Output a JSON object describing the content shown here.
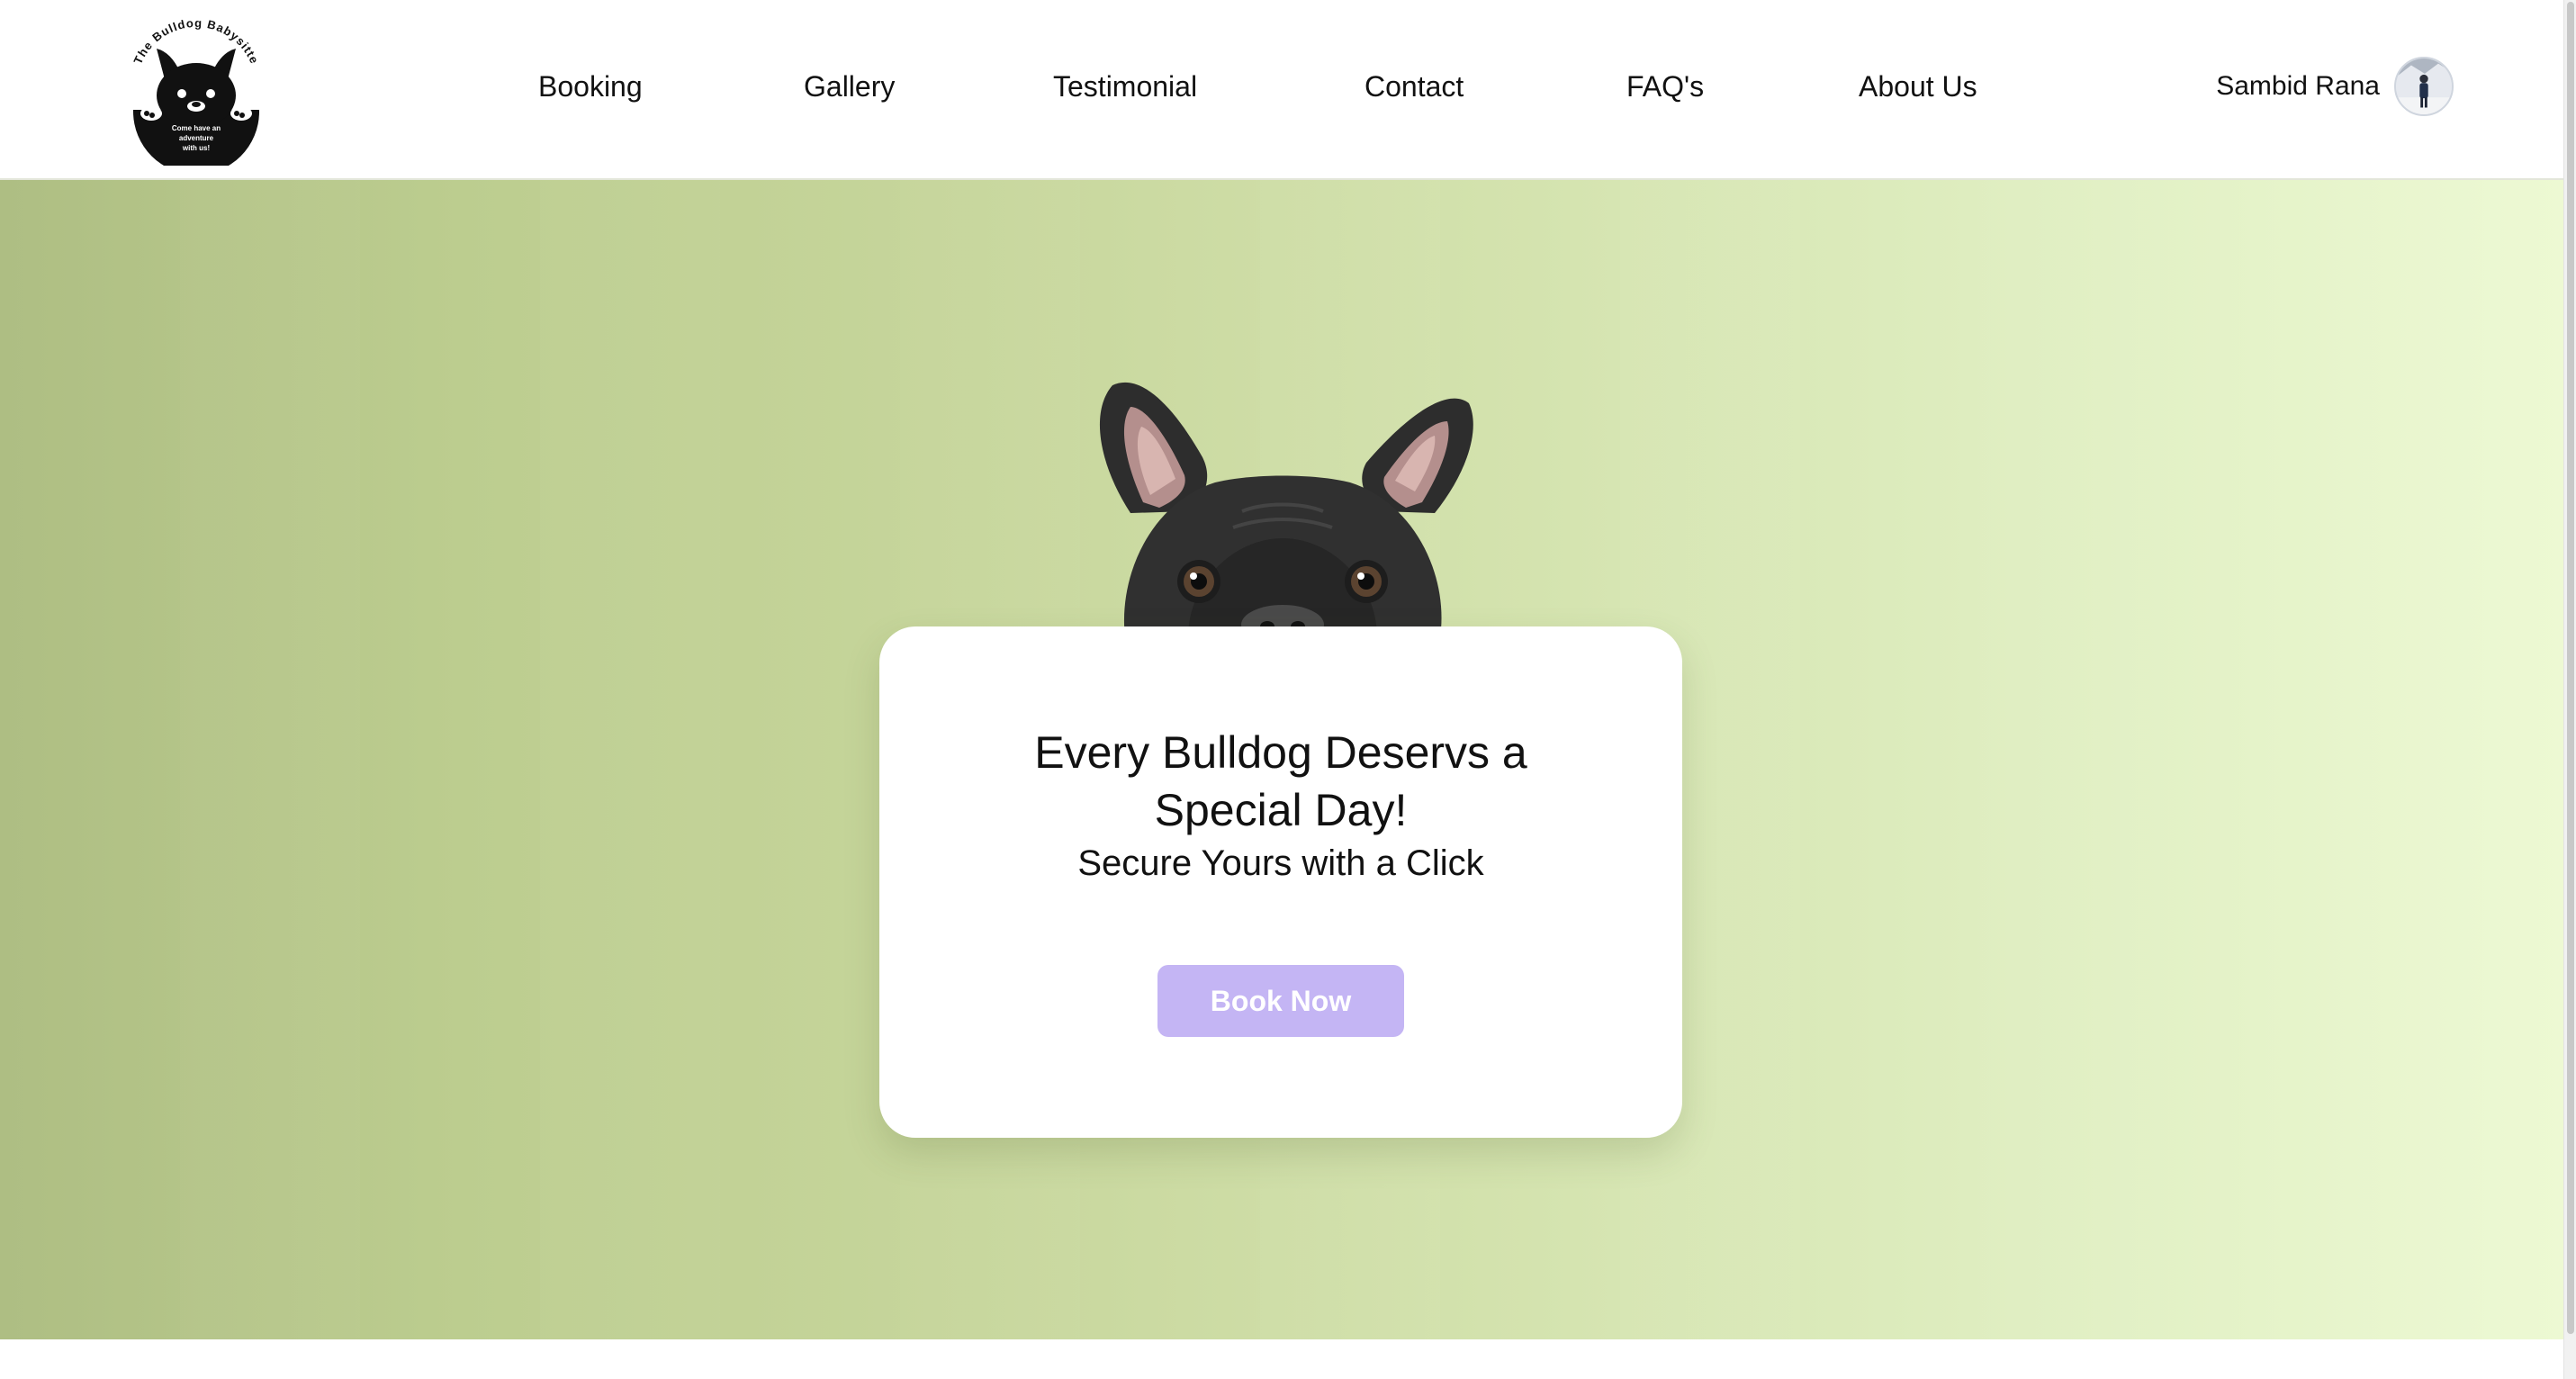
{
  "header": {
    "logo": {
      "arc_text": "The Bulldog Babysitte",
      "tagline_lines": [
        "Come have an",
        "adventure",
        "with us!"
      ]
    },
    "nav": [
      {
        "label": "Booking"
      },
      {
        "label": "Gallery"
      },
      {
        "label": "Testimonial"
      },
      {
        "label": "Contact"
      },
      {
        "label": "FAQ's"
      },
      {
        "label": "About Us"
      }
    ],
    "user": {
      "name": "Sambid Rana",
      "avatar_icon": "user-photo-icon"
    }
  },
  "hero": {
    "background_colors": [
      "#aebe83",
      "#edf9d3"
    ],
    "image_icon": "bulldog-peeking-icon",
    "card": {
      "title_line1": "Every Bulldog Deservs a",
      "title_line2": "Special Day!",
      "subtitle": "Secure Yours with a Click",
      "button_label": "Book Now",
      "button_color": "#c4b5f4"
    }
  }
}
